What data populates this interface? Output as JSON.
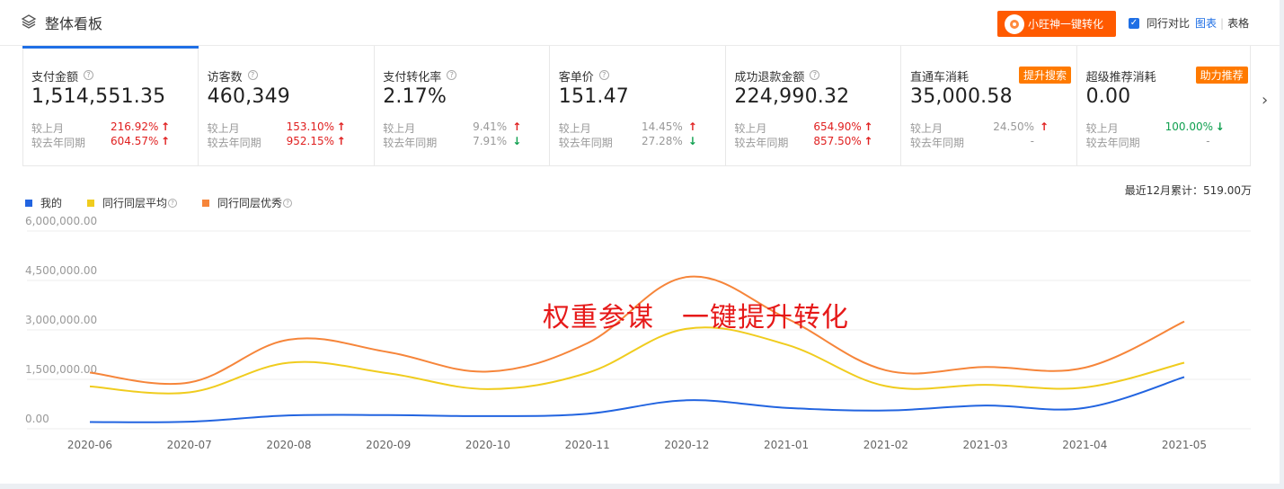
{
  "header": {
    "title": "整体看板",
    "promo_label": "小旺神一键转化",
    "compare_label": "同行对比",
    "view_chart": "图表",
    "view_table": "表格"
  },
  "cards": [
    {
      "label": "支付金额",
      "value": "1,514,551.35",
      "badge": "",
      "active": true,
      "rows": [
        {
          "label": "较上月",
          "pct": "216.92%",
          "dir": "up"
        },
        {
          "label": "较去年同期",
          "pct": "604.57%",
          "dir": "up"
        }
      ]
    },
    {
      "label": "访客数",
      "value": "460,349",
      "badge": "",
      "rows": [
        {
          "label": "较上月",
          "pct": "153.10%",
          "dir": "up"
        },
        {
          "label": "较去年同期",
          "pct": "952.15%",
          "dir": "up"
        }
      ]
    },
    {
      "label": "支付转化率",
      "value": "2.17%",
      "badge": "",
      "rows": [
        {
          "label": "较上月",
          "pct": "9.41%",
          "dir": "up",
          "grey": true
        },
        {
          "label": "较去年同期",
          "pct": "7.91%",
          "dir": "down",
          "grey": true
        }
      ]
    },
    {
      "label": "客单价",
      "value": "151.47",
      "badge": "",
      "rows": [
        {
          "label": "较上月",
          "pct": "14.45%",
          "dir": "up",
          "grey": true
        },
        {
          "label": "较去年同期",
          "pct": "27.28%",
          "dir": "down",
          "grey": true
        }
      ]
    },
    {
      "label": "成功退款金额",
      "value": "224,990.32",
      "badge": "",
      "rows": [
        {
          "label": "较上月",
          "pct": "654.90%",
          "dir": "up"
        },
        {
          "label": "较去年同期",
          "pct": "857.50%",
          "dir": "up"
        }
      ]
    },
    {
      "label": "直通车消耗",
      "value": "35,000.58",
      "badge": "提升搜索",
      "noq": true,
      "rows": [
        {
          "label": "较上月",
          "pct": "24.50%",
          "dir": "up",
          "grey": true
        },
        {
          "label": "较去年同期",
          "pct": "-",
          "dir": "none",
          "grey": true
        }
      ]
    },
    {
      "label": "超级推荐消耗",
      "value": "0.00",
      "badge": "助力推荐",
      "noq": true,
      "rows": [
        {
          "label": "较上月",
          "pct": "100.00%",
          "dir": "down",
          "greenpct": true
        },
        {
          "label": "较去年同期",
          "pct": "-",
          "dir": "none",
          "grey": true
        }
      ]
    }
  ],
  "cumulative": "最近12月累计：519.00万",
  "overlay_text": "权重参谋　一键提升转化",
  "chart_data": {
    "type": "line",
    "x": [
      "2020-06",
      "2020-07",
      "2020-08",
      "2020-09",
      "2020-10",
      "2020-11",
      "2020-12",
      "2021-01",
      "2021-02",
      "2021-03",
      "2021-04",
      "2021-05"
    ],
    "yticks": [
      "0.00",
      "1,500,000.00",
      "3,000,000.00",
      "4,500,000.00",
      "6,000,000.00"
    ],
    "ylim": [
      0,
      6000000
    ],
    "grid": true,
    "legend_position": "top-left",
    "series": [
      {
        "name": "我的",
        "color": "#2264e0",
        "values": [
          150000,
          160000,
          350000,
          360000,
          330000,
          400000,
          810000,
          580000,
          500000,
          650000,
          580000,
          1514551
        ]
      },
      {
        "name": "同行同层平均",
        "color": "#f0cc1e",
        "values": [
          1230000,
          1050000,
          1950000,
          1630000,
          1150000,
          1640000,
          2980000,
          2500000,
          1240000,
          1280000,
          1200000,
          1950000
        ]
      },
      {
        "name": "同行同层优秀",
        "color": "#f6853a",
        "values": [
          1650000,
          1350000,
          2650000,
          2270000,
          1680000,
          2540000,
          4550000,
          3300000,
          1720000,
          1820000,
          1800000,
          3200000
        ]
      }
    ]
  }
}
